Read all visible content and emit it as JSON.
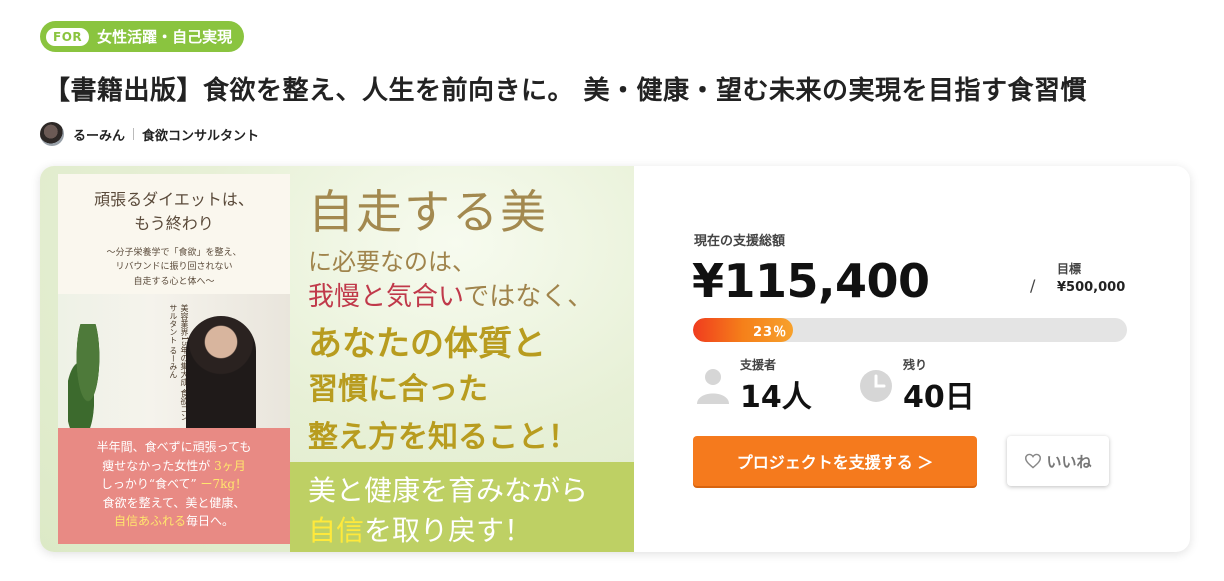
{
  "tag": {
    "badge": "FOR",
    "label": "女性活躍・自己実現"
  },
  "project": {
    "title": "【書籍出版】食欲を整え、人生を前向きに。 美・健康・望む未来の実現を目指す食習慣"
  },
  "author": {
    "name": "るーみん",
    "role": "食欲コンサルタント"
  },
  "hero": {
    "book_title_1": "頑張るダイエットは、",
    "book_title_2": "もう終わり",
    "book_sub_1": "〜分子栄養学で「食欲」を整え、",
    "book_sub_2": "リバウンドに振り回されない",
    "book_sub_3": "自走する心と体へ〜",
    "book_vertical": "美容業界15年の集大成 食欲コンサルタント るーみん",
    "pink_1": "半年間、食べずに頑張っても",
    "pink_2a": "痩せなかった女性が",
    "pink_2b": "3ヶ月",
    "pink_3a": "しっかり“食べて”",
    "pink_3b": "ー7kg！",
    "pink_4": "食欲を整えて、美と健康、",
    "pink_5a": "自信あふれる",
    "pink_5b": "毎日へ。",
    "line1": "自走する美",
    "line2": "に必要なのは、",
    "line3a": "我慢と気合い",
    "line3b": "ではなく、",
    "line4": "あなたの体質と",
    "line5": "習慣に合った",
    "line6": "整え方を知ること！",
    "line7": "美と健康を育みながら",
    "line8a": "自信",
    "line8b": "を取り戻す！"
  },
  "funding": {
    "total_label": "現在の支援総額",
    "amount": "¥115,400",
    "slash": "/",
    "goal_label": "目標",
    "goal_value": "¥500,000",
    "progress_text": "23％",
    "progress_percent": 23,
    "supporters_label": "支援者",
    "supporters_value": "14人",
    "remaining_label": "残り",
    "remaining_value": "40日",
    "support_button": "プロジェクトを支援する ＞",
    "like_button": "いいね"
  },
  "colors": {
    "accent": "#f57a1d",
    "tag": "#8ac43f",
    "progress_start": "#f03c1e"
  }
}
